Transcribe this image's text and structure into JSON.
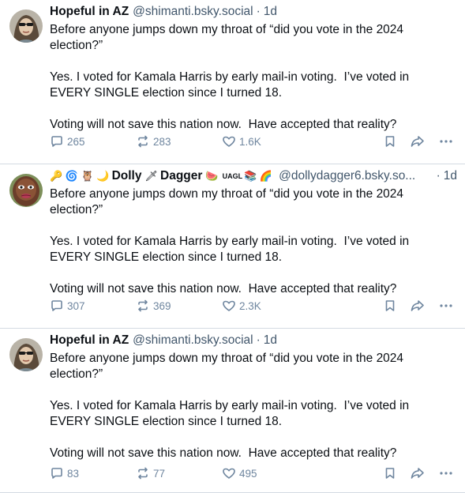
{
  "posts": [
    {
      "display_name": "Hopeful in AZ",
      "handle": "@shimanti.bsky.social",
      "separator": "·",
      "time": "1d",
      "body": "Before anyone jumps down my throat of “did you vote in the 2024 election?”\n\nYes. I voted for Kamala Harris by early mail-in voting.  I’ve voted in EVERY SINGLE election since I turned 18.\n\nVoting will not save this nation now.  Have accepted that reality?",
      "reply_count": "265",
      "repost_count": "283",
      "like_count": "1.6K"
    },
    {
      "display_name_prefix_emoji": "🔑 🌀 🦉 🌙",
      "display_name_part1": "Dolly",
      "display_name_mid_emoji": "🗡",
      "display_name_part2": "Dagger",
      "display_name_suffix_emoji": "🍉",
      "display_name_tag": "UAGL",
      "display_name_suffix_emoji2": "📚 🌈",
      "handle": "@dollydagger6.bsky.so...",
      "separator": "·",
      "time": "1d",
      "body": "Before anyone jumps down my throat of “did you vote in the 2024 election?”\n\nYes. I voted for Kamala Harris by early mail-in voting.  I’ve voted in EVERY SINGLE election since I turned 18.\n\nVoting will not save this nation now.  Have accepted that reality?",
      "reply_count": "307",
      "repost_count": "369",
      "like_count": "2.3K"
    },
    {
      "display_name": "Hopeful in AZ",
      "handle": "@shimanti.bsky.social",
      "separator": "·",
      "time": "1d",
      "body": "Before anyone jumps down my throat of “did you vote in the 2024 election?”\n\nYes. I voted for Kamala Harris by early mail-in voting.  I’ve voted in EVERY SINGLE election since I turned 18.\n\nVoting will not save this nation now.  Have accepted that reality?",
      "reply_count": "83",
      "repost_count": "77",
      "like_count": "495"
    }
  ],
  "icons": {
    "reply": "reply-icon",
    "repost": "repost-icon",
    "like": "heart-icon",
    "bookmark": "bookmark-icon",
    "share": "share-icon",
    "more": "more-icon"
  },
  "colors": {
    "text": "#0b0f14",
    "muted": "#42576c",
    "action": "#6f869f",
    "divider": "#d4dbe2"
  }
}
